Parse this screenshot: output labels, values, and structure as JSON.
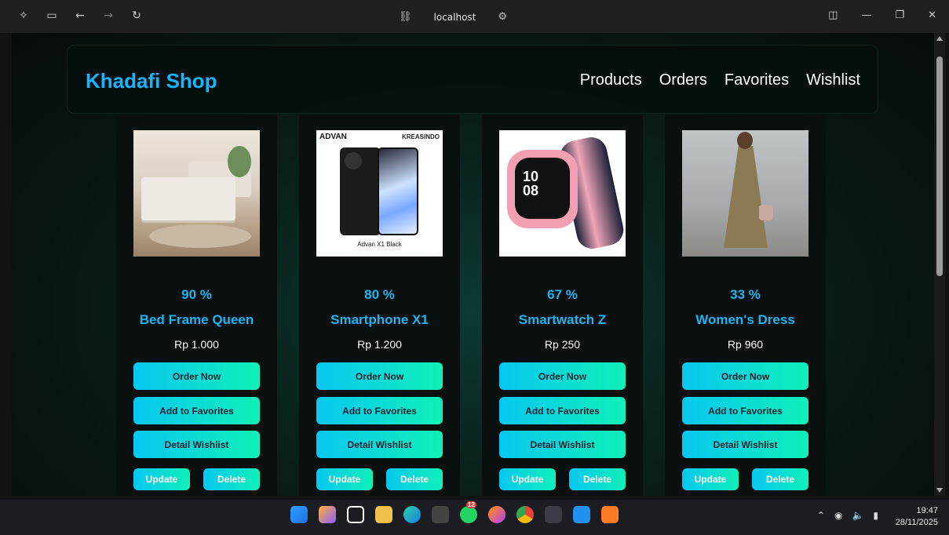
{
  "browser": {
    "address": "localhost"
  },
  "header": {
    "brand": "Khadafi Shop",
    "nav": [
      "Products",
      "Orders",
      "Favorites",
      "Wishlist"
    ]
  },
  "products": [
    {
      "percent": "90 %",
      "name": "Bed Frame Queen",
      "price": "Rp 1.000"
    },
    {
      "percent": "80 %",
      "name": "Smartphone X1",
      "price": "Rp 1.200"
    },
    {
      "percent": "67 %",
      "name": "Smartwatch Z",
      "price": "Rp 250"
    },
    {
      "percent": "33 %",
      "name": "Women's Dress",
      "price": "Rp 960"
    }
  ],
  "image_text": {
    "phone_brand": "ADVAN",
    "phone_brand2": "KREASINDO",
    "phone_caption": "Advan X1 Black",
    "watch_time_h": "10",
    "watch_time_m": "08"
  },
  "buttons": {
    "order": "Order Now",
    "favorite": "Add to Favorites",
    "wishlist": "Detail Wishlist",
    "update": "Update",
    "delete": "Delete"
  },
  "taskbar": {
    "badge": "12",
    "time": "19:47",
    "date": "28/11/2025"
  },
  "colors": {
    "accent": "#19b6f0",
    "button_start": "#08c7f0",
    "button_end": "#10f0b8"
  }
}
